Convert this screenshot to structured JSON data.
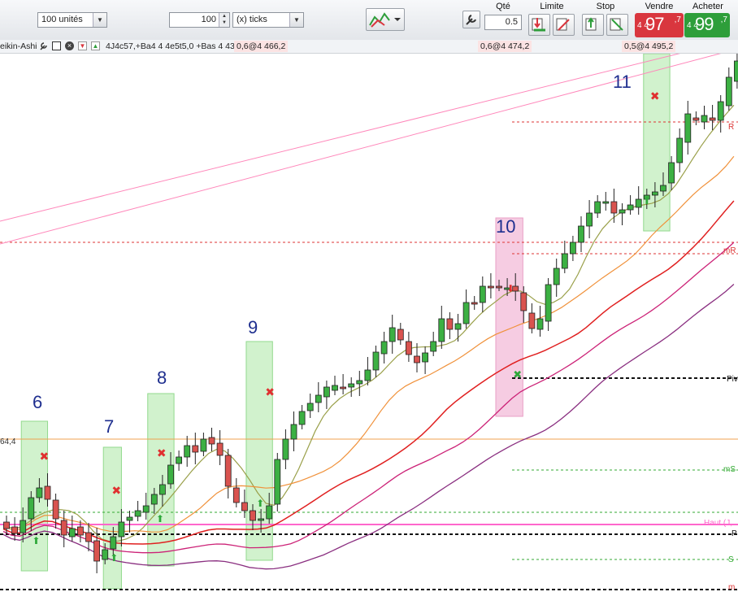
{
  "toolbar": {
    "units_value": "100 unités",
    "ticks_value": "100",
    "ticks_unit": "(x) ticks",
    "qty_label": "Qté",
    "qty_value": "0.5",
    "limit_label": "Limite",
    "stop_label": "Stop",
    "sell_label": "Vendre",
    "buy_label": "Acheter",
    "sell_price_small": "4 4",
    "sell_price_big": "97",
    "sell_price_sup": ",7",
    "buy_price_small": "4 4",
    "buy_price_big": "99",
    "buy_price_sup": ",7",
    "sell_color": "#d9363e",
    "buy_color": "#2e9e3a"
  },
  "header": {
    "chart_type": "eikin-Ashi",
    "info_text": "4J4c57,+Ba4 4 4e5t5,0 +Bas 4 431,2",
    "tag_left": "0,6@4 466,2",
    "tag_mid": "0,6@4 474,2",
    "tag_right": "0,5@4 495,2"
  },
  "waves": [
    "6",
    "7",
    "8",
    "9",
    "10",
    "11"
  ],
  "right_labels": {
    "r1": "R",
    "mr1": "mR",
    "pivot": "Piv",
    "ms1": "mS",
    "high": "Haut (J,",
    "p": "P",
    "s1": "S",
    "m_bottom": "m"
  },
  "left_label": "64,4",
  "colors": {
    "bull": "#3cb043",
    "bear": "#d9534f",
    "zone_green": "#c9f0c5",
    "zone_pink": "#f5c4dd"
  },
  "chart_data": {
    "type": "candlestick",
    "x": [
      0,
      1,
      2,
      3,
      4,
      5,
      6,
      7,
      8,
      9,
      10,
      11,
      12,
      13,
      14,
      15,
      16,
      17,
      18,
      19,
      20,
      21,
      22,
      23,
      24,
      25,
      26,
      27,
      28,
      29,
      30,
      31,
      32,
      33,
      34,
      35,
      36,
      37,
      38,
      39,
      40,
      41,
      42,
      43,
      44,
      45,
      46,
      47,
      48,
      49,
      50,
      51,
      52,
      53,
      54,
      55,
      56,
      57,
      58,
      59,
      60,
      61,
      62,
      63,
      64,
      65,
      66,
      67,
      68,
      69,
      70,
      71,
      72,
      73,
      74,
      75,
      76,
      77,
      78,
      79,
      80,
      81,
      82,
      83,
      84,
      85,
      86,
      87,
      88,
      89
    ],
    "series": [
      {
        "open": [
          642,
          648,
          655,
          638,
          612,
          598,
          615,
          640,
          660,
          648,
          655,
          665,
          688,
          675,
          660,
          640,
          635,
          630,
          620,
          608,
          595,
          570,
          562,
          548,
          555,
          538,
          545,
          560,
          600,
          618,
          628,
          640,
          638,
          620,
          565,
          540,
          522,
          505,
          495,
          488,
          480,
          476,
          476,
          472,
          468,
          455,
          435,
          420,
          405,
          420,
          438,
          445,
          432,
          420,
          392,
          405,
          398,
          372,
          372,
          352,
          352,
          355,
          352,
          360,
          385,
          405,
          395,
          350,
          330,
          312,
          298,
          278,
          262,
          250,
          248,
          262,
          258,
          255,
          245,
          240,
          235,
          225,
          200,
          175,
          145,
          150,
          145,
          148,
          130,
          100
        ],
        "close": [
          650,
          656,
          640,
          612,
          600,
          614,
          638,
          658,
          650,
          658,
          666,
          690,
          676,
          660,
          642,
          636,
          628,
          622,
          608,
          596,
          572,
          562,
          548,
          556,
          540,
          546,
          560,
          598,
          618,
          628,
          640,
          638,
          622,
          565,
          540,
          522,
          506,
          496,
          486,
          476,
          474,
          476,
          472,
          468,
          455,
          433,
          420,
          403,
          418,
          436,
          446,
          434,
          420,
          392,
          405,
          398,
          372,
          372,
          352,
          352,
          352,
          354,
          358,
          382,
          404,
          392,
          350,
          330,
          312,
          298,
          278,
          262,
          248,
          248,
          262,
          258,
          252,
          245,
          240,
          236,
          228,
          200,
          170,
          140,
          148,
          142,
          148,
          125,
          95,
          75
        ]
      }
    ],
    "price_lines": [
      0,
      150,
      298,
      312,
      465,
      540,
      578,
      630,
      645,
      657,
      688,
      725
    ],
    "wave_labels": [
      "6",
      "7",
      "8",
      "9",
      "10",
      "11"
    ]
  }
}
